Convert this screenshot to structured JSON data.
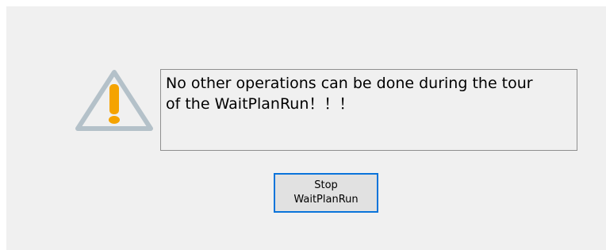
{
  "dialog": {
    "message": "No other operations can be done during the tour\nof the WaitPlanRun！！！",
    "icon": "warning-triangle-icon",
    "stop_button": {
      "label_line1": "Stop",
      "label_line2": "WaitPlanRun"
    }
  },
  "colors": {
    "panel_background": "#f0f0f0",
    "icon_triangle": "#b4c1c9",
    "icon_exclamation": "#f5a300",
    "button_border": "#0a74da",
    "button_background": "#e1e1e1"
  }
}
